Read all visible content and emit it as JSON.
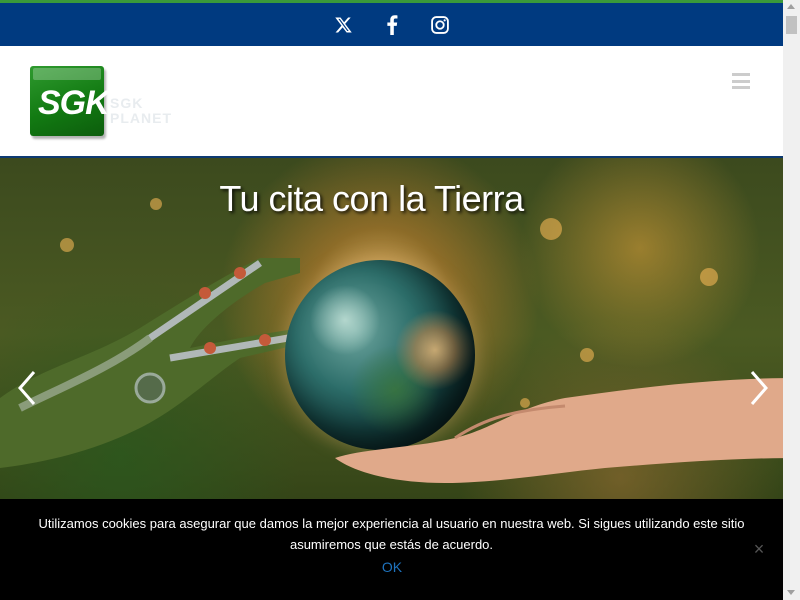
{
  "social": {
    "items": [
      {
        "name": "x-twitter-icon"
      },
      {
        "name": "facebook-icon"
      },
      {
        "name": "instagram-icon"
      }
    ]
  },
  "header": {
    "logo_text": "SGK",
    "logo_subtitle": "SGK PLANET",
    "menu_icon": "hamburger-menu-icon"
  },
  "slider": {
    "title": "Tu cita con la Tierra",
    "prev_icon": "chevron-left-icon",
    "next_icon": "chevron-right-icon"
  },
  "cookie": {
    "message": "Utilizamos cookies para asegurar que damos la mejor experiencia al usuario en nuestra web. Si sigues utilizando este sitio asumiremos que estás de acuerdo.",
    "ok_label": "OK",
    "close_label": "×"
  },
  "colors": {
    "top_bar": "#003a80",
    "top_accent": "#3a9a3a",
    "logo_green": "#127a12",
    "header_border": "#0d3a72",
    "cookie_bg": "#000000",
    "ok_link": "#1e73be"
  }
}
